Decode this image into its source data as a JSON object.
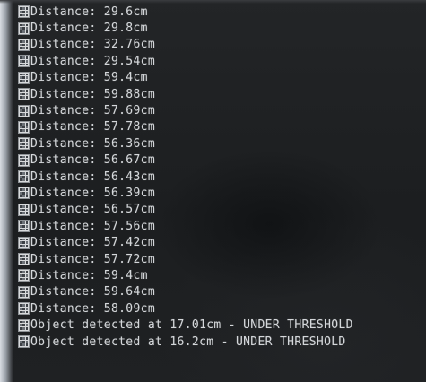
{
  "terminal": {
    "lines": [
      "Distance: 29.6cm",
      "Distance: 29.8cm",
      "Distance: 32.76cm",
      "Distance: 29.54cm",
      "Distance: 59.4cm",
      "Distance: 59.88cm",
      "Distance: 57.69cm",
      "Distance: 57.78cm",
      "Distance: 56.36cm",
      "Distance: 56.67cm",
      "Distance: 56.43cm",
      "Distance: 56.39cm",
      "Distance: 56.57cm",
      "Distance: 57.56cm",
      "Distance: 57.42cm",
      "Distance: 57.72cm",
      "Distance: 59.4cm",
      "Distance: 59.64cm",
      "Distance: 58.09cm",
      "Object detected at 17.01cm - UNDER THRESHOLD",
      "Object detected at 16.2cm - UNDER THRESHOLD"
    ],
    "line_prefix_icon": "unprintable-character-glyph-icon"
  },
  "colors": {
    "background": "#1f2123",
    "text": "#d4d7da",
    "glyph_box": "#d8dadc"
  }
}
